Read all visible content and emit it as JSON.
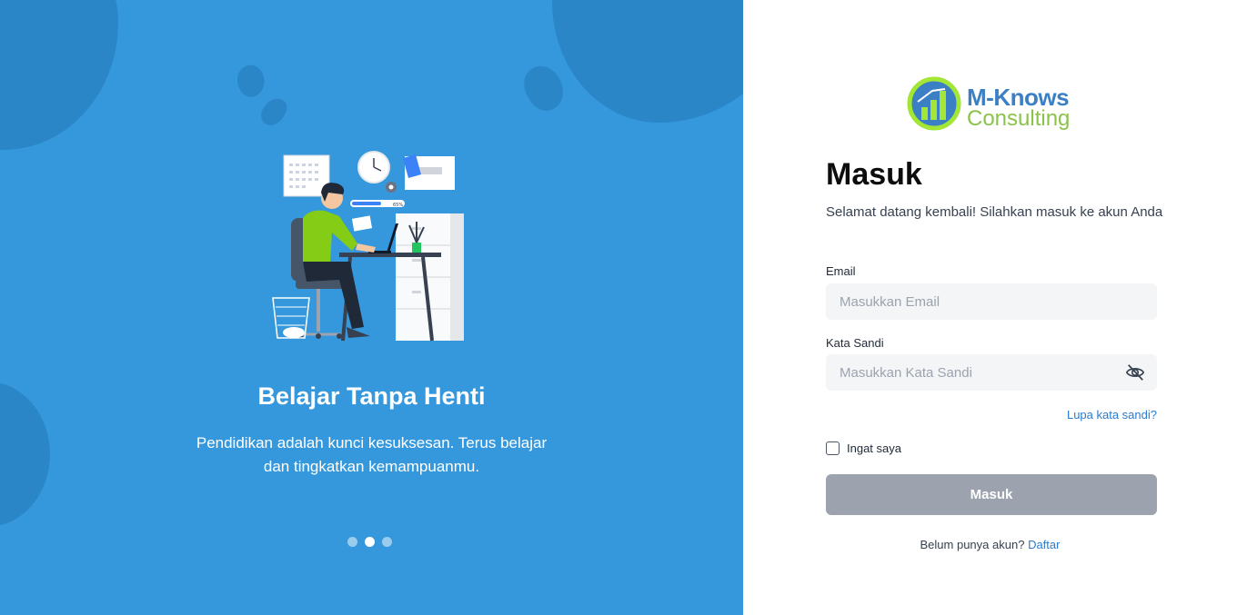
{
  "slide": {
    "title": "Belajar Tanpa Henti",
    "description": "Pendidikan adalah kunci kesuksesan. Terus belajar dan tingkatkan kemampuanmu.",
    "progress_label": "65%",
    "dots": [
      {
        "active": false
      },
      {
        "active": true
      },
      {
        "active": false
      }
    ]
  },
  "logo": {
    "line1": "M-Knows",
    "line2": "Consulting"
  },
  "form": {
    "title": "Masuk",
    "subtitle": "Selamat datang kembali! Silahkan masuk ke akun Anda",
    "email_label": "Email",
    "email_placeholder": "Masukkan Email",
    "password_label": "Kata Sandi",
    "password_placeholder": "Masukkan Kata Sandi",
    "forgot_label": "Lupa kata sandi?",
    "remember_label": "Ingat saya",
    "submit_label": "Masuk",
    "register_prompt": "Belum punya akun?",
    "register_link": "Daftar"
  },
  "colors": {
    "left_bg": "#3598dc",
    "accent_link": "#2a7ccf",
    "button_disabled": "#9ca3af",
    "logo_blue": "#3b7fc4",
    "logo_green": "#8bc34a"
  }
}
